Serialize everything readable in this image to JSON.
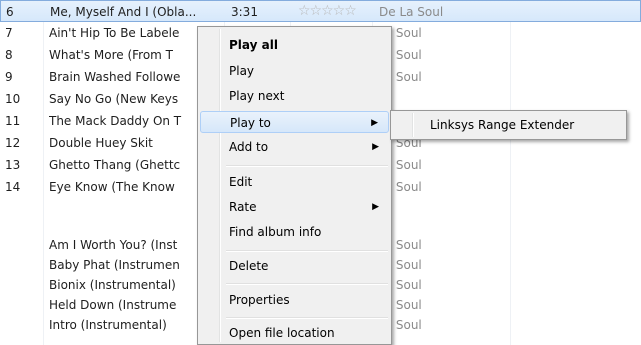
{
  "tracks": [
    {
      "num": "6",
      "title": "Me, Myself And I (Obla...",
      "duration": "3:31",
      "artist": "De La Soul",
      "rating": "☆☆☆☆☆",
      "selected": true
    },
    {
      "num": "7",
      "title": "Ain't Hip To Be Labele",
      "duration": "",
      "artist": "La Soul"
    },
    {
      "num": "8",
      "title": "What's More (From T",
      "duration": "",
      "artist": "La Soul"
    },
    {
      "num": "9",
      "title": "Brain Washed Followe",
      "duration": "",
      "artist": "La Soul"
    },
    {
      "num": "10",
      "title": "Say No Go (New Keys",
      "duration": "",
      "artist": ""
    },
    {
      "num": "11",
      "title": "The Mack Daddy On T",
      "duration": "",
      "artist": ""
    },
    {
      "num": "12",
      "title": "Double Huey Skit",
      "duration": "",
      "artist": "La Soul"
    },
    {
      "num": "13",
      "title": "Ghetto Thang (Ghettc",
      "duration": "",
      "artist": "La Soul"
    },
    {
      "num": "14",
      "title": "Eye Know (The Know",
      "duration": "",
      "artist": "La Soul"
    },
    {
      "num": "",
      "title": "",
      "duration": "",
      "artist": ""
    },
    {
      "num": "",
      "title": "Am I Worth You? (Inst",
      "duration": "",
      "artist": "La Soul"
    },
    {
      "num": "",
      "title": "Baby Phat (Instrumen",
      "duration": "",
      "artist": "La Soul"
    },
    {
      "num": "",
      "title": "Bionix (Instrumental)",
      "duration": "",
      "artist": "La Soul"
    },
    {
      "num": "",
      "title": "Held Down (Instrume",
      "duration": "",
      "artist": "La Soul"
    },
    {
      "num": "",
      "title": "Intro (Instrumental)",
      "duration": "",
      "artist": "La Soul"
    }
  ],
  "context_menu": {
    "items": [
      {
        "label": "Play all",
        "bold": true
      },
      {
        "label": "Play"
      },
      {
        "label": "Play next"
      },
      {
        "label": "Play to",
        "submenu": true,
        "hover": true
      },
      {
        "label": "Add to",
        "submenu": true
      },
      {
        "label": "Edit"
      },
      {
        "label": "Rate",
        "submenu": true
      },
      {
        "label": "Find album info"
      },
      {
        "label": "Delete"
      },
      {
        "label": "Properties"
      },
      {
        "label": "Open file location"
      }
    ],
    "arrow_glyph": "▶"
  },
  "play_to_submenu": {
    "items": [
      {
        "label": "Linksys Range Extender"
      }
    ]
  },
  "colors": {
    "selection_bg": "#d6e8fb",
    "selection_border": "#84acdd",
    "menu_bg": "#f0f0f0",
    "menu_hover": "#d6e7fa"
  }
}
